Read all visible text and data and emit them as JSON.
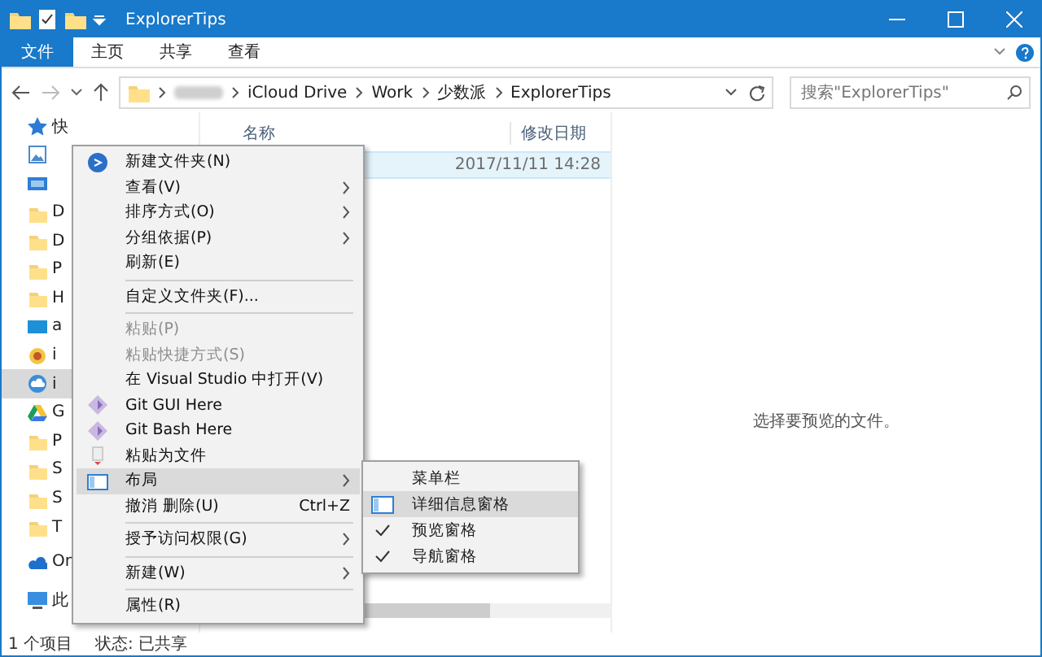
{
  "window": {
    "title": "ExplorerTips"
  },
  "ribbon_tabs": [
    {
      "label": "文件",
      "selected": true
    },
    {
      "label": "主页",
      "selected": false
    },
    {
      "label": "共享",
      "selected": false
    },
    {
      "label": "查看",
      "selected": false
    }
  ],
  "address_bar": {
    "segments": [
      "iCloud Drive",
      "Work",
      "少数派",
      "ExplorerTips"
    ]
  },
  "search": {
    "placeholder": "搜索\"ExplorerTips\""
  },
  "columns": [
    "名称",
    "修改日期"
  ],
  "rows": [
    {
      "modified": "2017/11/11 14:28",
      "selected": true
    }
  ],
  "sidebar": {
    "items": [
      {
        "kind": "star",
        "label": "快",
        "selected": false
      },
      {
        "kind": "image",
        "selected": false
      },
      {
        "kind": "monitor",
        "selected": false
      },
      {
        "kind": "folder",
        "label": "D",
        "selected": false
      },
      {
        "kind": "folder",
        "label": "D",
        "selected": false
      },
      {
        "kind": "folder",
        "label": "P",
        "selected": false
      },
      {
        "kind": "folder",
        "label": "H",
        "selected": false
      },
      {
        "kind": "desktop",
        "label": "a",
        "selected": false
      },
      {
        "kind": "app",
        "label": "i",
        "selected": false
      },
      {
        "kind": "cloud",
        "label": "i",
        "selected": true
      },
      {
        "kind": "drive",
        "label": "G",
        "selected": false
      },
      {
        "kind": "folder",
        "label": "P",
        "selected": false
      },
      {
        "kind": "folder",
        "label": "S",
        "selected": false
      },
      {
        "kind": "folder",
        "label": "S",
        "selected": false
      },
      {
        "kind": "folder",
        "label": "T",
        "selected": false
      },
      {
        "kind": "onedrive",
        "label": "On",
        "selected": false
      },
      {
        "kind": "pc",
        "label": "此",
        "selected": false
      }
    ]
  },
  "preview": {
    "message": "选择要预览的文件。"
  },
  "status_bar": {
    "count": "1 个项目",
    "state": "状态: 已共享"
  },
  "context_menu": {
    "items": [
      {
        "kind": "item",
        "label": "新建文件夹(N)",
        "submenu": false,
        "disabled": false,
        "selected": false
      },
      {
        "kind": "item",
        "label": "查看(V)",
        "submenu": true,
        "disabled": false,
        "selected": false
      },
      {
        "kind": "item",
        "label": "排序方式(O)",
        "submenu": true,
        "disabled": false,
        "selected": false
      },
      {
        "kind": "item",
        "label": "分组依据(P)",
        "submenu": true,
        "disabled": false,
        "selected": false
      },
      {
        "kind": "item",
        "label": "刷新(E)",
        "submenu": false,
        "disabled": false,
        "selected": false
      },
      {
        "kind": "separator"
      },
      {
        "kind": "item",
        "label": "自定义文件夹(F)...",
        "submenu": false,
        "disabled": false,
        "selected": false
      },
      {
        "kind": "separator"
      },
      {
        "kind": "item",
        "label": "粘贴(P)",
        "submenu": false,
        "disabled": true,
        "selected": false
      },
      {
        "kind": "item",
        "label": "粘贴快捷方式(S)",
        "submenu": false,
        "disabled": true,
        "selected": false
      },
      {
        "kind": "item",
        "label": "在 Visual Studio 中打开(V)",
        "submenu": false,
        "disabled": false,
        "selected": false
      },
      {
        "kind": "item",
        "label": "Git GUI Here",
        "submenu": false,
        "disabled": false,
        "selected": false
      },
      {
        "kind": "item",
        "label": "Git Bash Here",
        "submenu": false,
        "disabled": false,
        "selected": false
      },
      {
        "kind": "item",
        "label": "粘贴为文件",
        "submenu": false,
        "disabled": false,
        "selected": false
      },
      {
        "kind": "item",
        "label": "布局",
        "submenu": true,
        "disabled": false,
        "selected": true
      },
      {
        "kind": "item",
        "label": "撤消 删除(U)",
        "shortcut": "Ctrl+Z",
        "submenu": false,
        "disabled": false,
        "selected": false
      },
      {
        "kind": "separator"
      },
      {
        "kind": "item",
        "label": "授予访问权限(G)",
        "submenu": true,
        "disabled": false,
        "selected": false
      },
      {
        "kind": "separator"
      },
      {
        "kind": "item",
        "label": "新建(W)",
        "submenu": true,
        "disabled": false,
        "selected": false
      },
      {
        "kind": "separator"
      },
      {
        "kind": "item",
        "label": "属性(R)",
        "submenu": false,
        "disabled": false,
        "selected": false
      }
    ]
  },
  "submenu": {
    "items": [
      {
        "label": "菜单栏",
        "checked": false,
        "selected": false
      },
      {
        "label": "详细信息窗格",
        "checked": false,
        "selected": true
      },
      {
        "label": "预览窗格",
        "checked": true,
        "selected": false
      },
      {
        "label": "导航窗格",
        "checked": true,
        "selected": false
      }
    ]
  }
}
